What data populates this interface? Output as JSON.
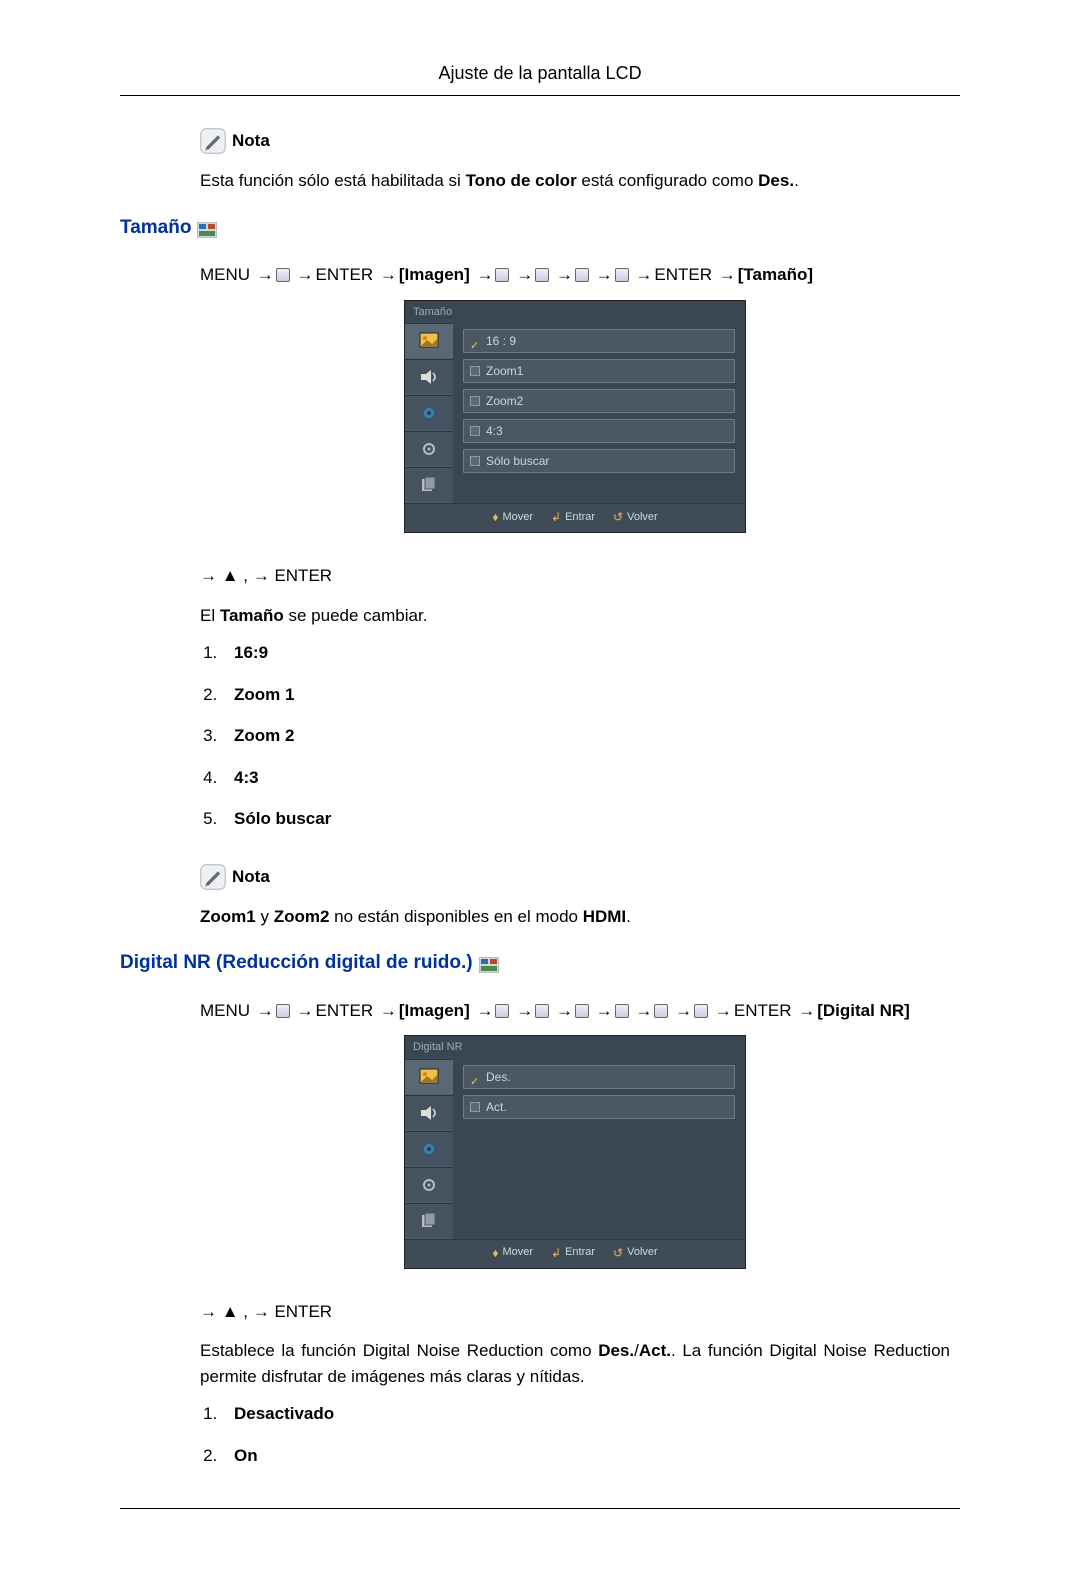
{
  "header": {
    "title": "Ajuste de la pantalla LCD"
  },
  "note1": {
    "label": "Nota",
    "text_pre": "Esta función sólo está habilitada si ",
    "bold1": "Tono de color",
    "text_mid": " está configurado como ",
    "bold2": "Des.",
    "text_post": "."
  },
  "section_tamano": {
    "heading": "Tamaño",
    "path": {
      "menu": "MENU",
      "enter": "ENTER",
      "imagen": "[Imagen]",
      "tamano": "[Tamaño]"
    },
    "osd": {
      "title": "Tamaño",
      "items": [
        {
          "label": "16 : 9",
          "sel": true
        },
        {
          "label": "Zoom1",
          "sel": false
        },
        {
          "label": "Zoom2",
          "sel": false
        },
        {
          "label": "4:3",
          "sel": false
        },
        {
          "label": "Sólo buscar",
          "sel": false
        }
      ],
      "footer": {
        "move": "Mover",
        "enter": "Entrar",
        "return": "Volver"
      }
    },
    "seq_pre": "→ ▲ , ",
    "seq_post": " → ENTER",
    "desc_pre": "El ",
    "desc_bold": "Tamaño",
    "desc_post": " se puede cambiar.",
    "options": [
      "16:9",
      "Zoom 1",
      "Zoom 2",
      "4:3",
      "Sólo buscar"
    ]
  },
  "note2": {
    "label": "Nota",
    "b1": "Zoom1",
    "mid1": " y ",
    "b2": "Zoom2",
    "mid2": " no están disponibles en el modo ",
    "b3": "HDMI",
    "post": "."
  },
  "section_dnr": {
    "heading": "Digital NR (Reducción digital de ruido.)",
    "path": {
      "menu": "MENU",
      "enter": "ENTER",
      "imagen": "[Imagen]",
      "dnr": "[Digital NR]"
    },
    "osd": {
      "title": "Digital  NR",
      "items": [
        {
          "label": "Des.",
          "sel": true
        },
        {
          "label": "Act.",
          "sel": false
        }
      ],
      "footer": {
        "move": "Mover",
        "enter": "Entrar",
        "return": "Volver"
      }
    },
    "seq_pre": "→ ▲ , ",
    "seq_post": " → ENTER",
    "desc_pre": "Establece la función Digital Noise Reduction como ",
    "desc_b1": "Des.",
    "desc_slash": "/",
    "desc_b2": "Act.",
    "desc_post": ". La función Digital Noise Reduction permite disfrutar de imágenes más claras y nítidas.",
    "options": [
      "Desactivado",
      "On"
    ]
  }
}
